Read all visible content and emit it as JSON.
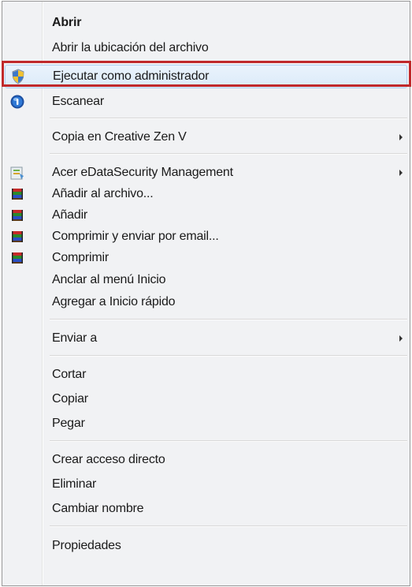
{
  "context_menu": {
    "items": {
      "open": "Abrir",
      "open_location": "Abrir la ubicación del archivo",
      "run_as_admin": "Ejecutar como administrador",
      "scan": "Escanear",
      "copy_to_zen": "Copia en Creative Zen V",
      "acer_security": "Acer eDataSecurity Management",
      "add_to_archive": "Añadir al archivo...",
      "add": "Añadir",
      "compress_email": "Comprimir y enviar por email...",
      "compress": "Comprimir",
      "pin_start": "Anclar al menú Inicio",
      "add_quick_launch": "Agregar a Inicio rápido",
      "send_to": "Enviar a",
      "cut": "Cortar",
      "copy": "Copiar",
      "paste": "Pegar",
      "create_shortcut": "Crear acceso directo",
      "delete": "Eliminar",
      "rename": "Cambiar nombre",
      "properties": "Propiedades"
    },
    "icons": {
      "run_as_admin": "uac-shield-icon",
      "scan": "antivirus-scan-icon",
      "acer_security": "acer-security-icon",
      "winrar": "winrar-icon",
      "submenu": "submenu-arrow-icon"
    },
    "colors": {
      "highlight_outline": "#c0292b",
      "hover_fill": "#dbeaf9"
    }
  }
}
